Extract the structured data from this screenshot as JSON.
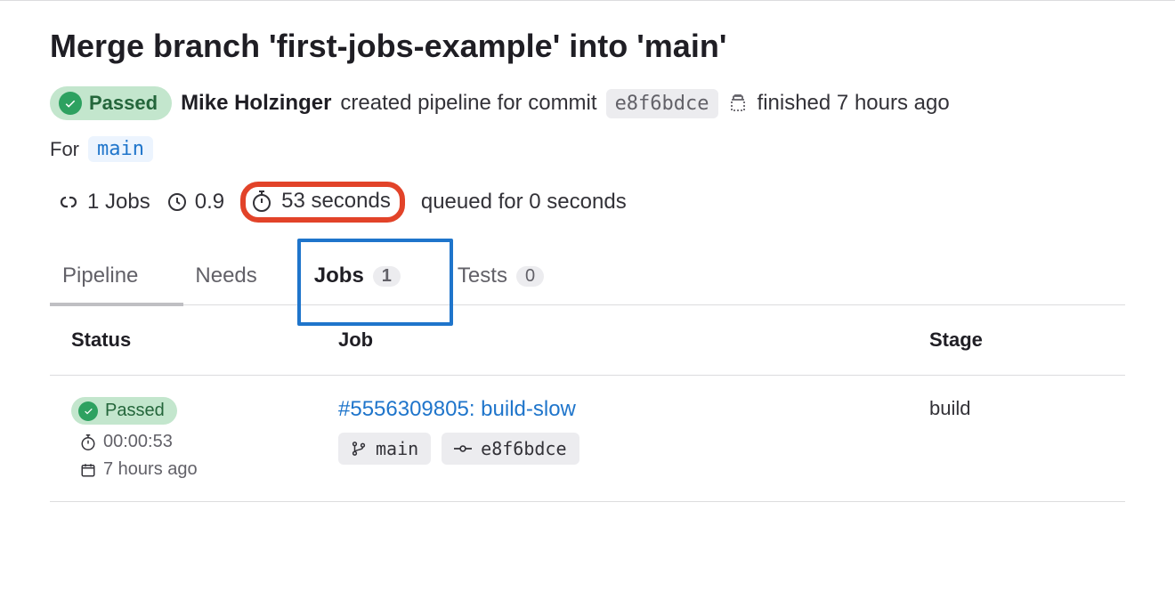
{
  "title": "Merge branch 'first-jobs-example' into 'main'",
  "status_badge": "Passed",
  "author": "Mike Holzinger",
  "created_text": "created pipeline for commit",
  "commit_sha": "e8f6bdce",
  "finished_text": "finished 7 hours ago",
  "for_label": "For",
  "for_branch": "main",
  "stats": {
    "jobs_count": "1 Jobs",
    "score": "0.9",
    "duration": "53 seconds",
    "queued": "queued for 0 seconds"
  },
  "tabs": [
    {
      "label": "Pipeline",
      "count": null,
      "active": false
    },
    {
      "label": "Needs",
      "count": null,
      "active": false
    },
    {
      "label": "Jobs",
      "count": "1",
      "active": true
    },
    {
      "label": "Tests",
      "count": "0",
      "active": false
    }
  ],
  "columns": {
    "status": "Status",
    "job": "Job",
    "stage": "Stage"
  },
  "rows": [
    {
      "status": "Passed",
      "duration": "00:00:53",
      "relative_time": "7 hours ago",
      "job_link": "#5556309805: build-slow",
      "branch": "main",
      "commit": "e8f6bdce",
      "stage": "build"
    }
  ]
}
